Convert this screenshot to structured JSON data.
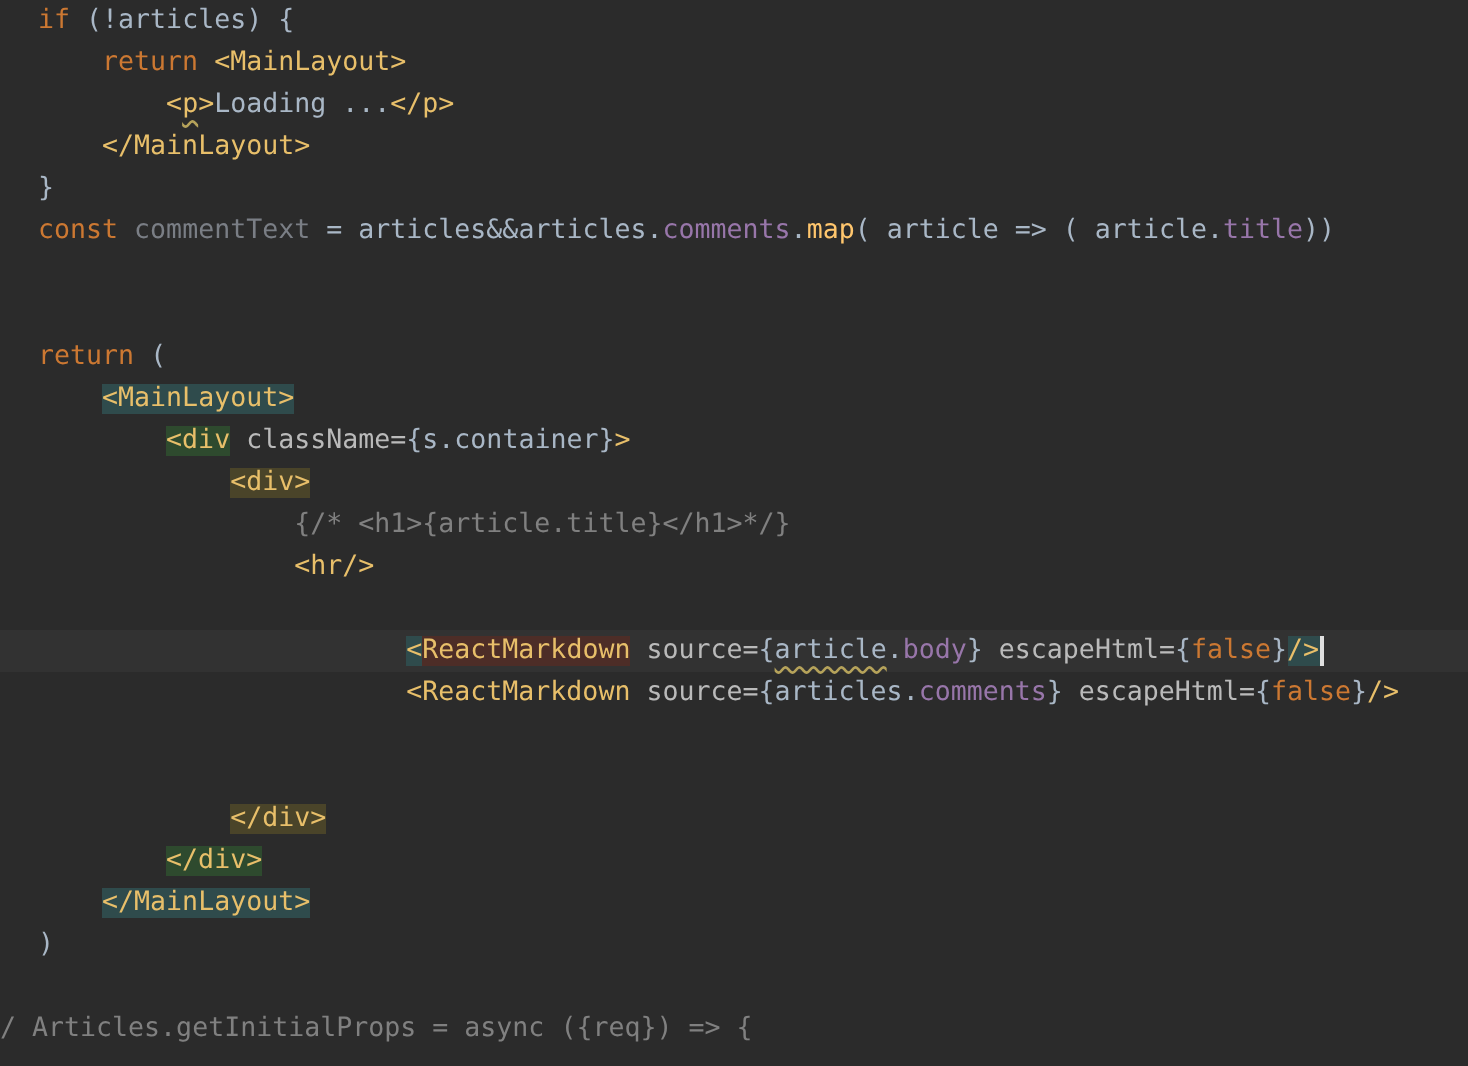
{
  "editor": {
    "lines": [
      {
        "kind": "code",
        "tokens": [
          {
            "t": "if",
            "kind": "kw"
          },
          {
            "t": " (!articles) {",
            "kind": "txt"
          }
        ]
      },
      {
        "kind": "code",
        "tokens": [
          {
            "t": "    return",
            "kind": "kw"
          },
          {
            "t": " <MainLayout>",
            "kind": "tag"
          }
        ]
      },
      {
        "kind": "code",
        "tokens": [
          {
            "t": "        <",
            "kind": "tag"
          },
          {
            "t": "p",
            "kind": "tag",
            "warn": true
          },
          {
            "t": ">",
            "kind": "tag"
          },
          {
            "t": "Loading ...",
            "kind": "txt"
          },
          {
            "t": "</p>",
            "kind": "tag"
          }
        ]
      },
      {
        "kind": "code",
        "tokens": [
          {
            "t": "    </MainLayout>",
            "kind": "tag"
          }
        ]
      },
      {
        "kind": "code",
        "tokens": [
          {
            "t": "}",
            "kind": "txt"
          }
        ]
      },
      {
        "kind": "code",
        "tokens": [
          {
            "t": "const",
            "kind": "kw"
          },
          {
            "t": " commentText",
            "kind": "unused"
          },
          {
            "t": " = articles&&articles.",
            "kind": "txt"
          },
          {
            "t": "comments",
            "kind": "prop"
          },
          {
            "t": ".",
            "kind": "txt"
          },
          {
            "t": "map",
            "kind": "fn"
          },
          {
            "t": "( article => ( article.",
            "kind": "txt"
          },
          {
            "t": "title",
            "kind": "prop"
          },
          {
            "t": "))",
            "kind": "txt"
          }
        ]
      },
      {
        "kind": "blank"
      },
      {
        "kind": "blank"
      },
      {
        "kind": "code",
        "tokens": [
          {
            "t": "return",
            "kind": "kw"
          },
          {
            "t": " (",
            "kind": "txt"
          }
        ]
      },
      {
        "kind": "code",
        "tokens": [
          {
            "t": "    <MainLayout>",
            "kind": "tag",
            "color": "#2f4b4c"
          }
        ]
      },
      {
        "kind": "code",
        "tokens": [
          {
            "t": "        <div",
            "kind": "tag",
            "color": "#2e4a2e"
          },
          {
            "t": " className=",
            "kind": "attr"
          },
          {
            "t": "{s.container}",
            "kind": "txt"
          },
          {
            "t": ">",
            "kind": "tag"
          }
        ]
      },
      {
        "kind": "code",
        "tokens": [
          {
            "t": "            <div>",
            "kind": "tag",
            "color": "#4a4429"
          }
        ]
      },
      {
        "kind": "code",
        "tokens": [
          {
            "t": "                {/* <h1>{article.title}</h1>*/}",
            "kind": "cmt"
          }
        ]
      },
      {
        "kind": "code",
        "tokens": [
          {
            "t": "                <hr/>",
            "kind": "tag"
          }
        ]
      },
      {
        "kind": "blank"
      },
      {
        "kind": "code",
        "current": true,
        "tokens": [
          {
            "t": "                       <",
            "kind": "tag",
            "color": "#2f4b4c"
          },
          {
            "t": "ReactMarkdown",
            "kind": "tag",
            "color": "#4d2d27"
          },
          {
            "t": " source=",
            "kind": "attr"
          },
          {
            "t": "{",
            "kind": "txt"
          },
          {
            "t": "article",
            "kind": "txt",
            "warn": true
          },
          {
            "t": ".",
            "kind": "txt"
          },
          {
            "t": "body",
            "kind": "prop"
          },
          {
            "t": "} ",
            "kind": "txt"
          },
          {
            "t": "escapeHtml=",
            "kind": "attr"
          },
          {
            "t": "{",
            "kind": "txt"
          },
          {
            "t": "false",
            "kind": "kw"
          },
          {
            "t": "}",
            "kind": "txt"
          },
          {
            "t": "/>",
            "kind": "tag",
            "color": "#2f4b4c",
            "cursor": true
          }
        ]
      },
      {
        "kind": "code",
        "tokens": [
          {
            "t": "                       <ReactMarkdown",
            "kind": "tag"
          },
          {
            "t": " source=",
            "kind": "attr"
          },
          {
            "t": "{articles.",
            "kind": "txt"
          },
          {
            "t": "comments",
            "kind": "prop"
          },
          {
            "t": "} ",
            "kind": "txt"
          },
          {
            "t": "escapeHtml=",
            "kind": "attr"
          },
          {
            "t": "{",
            "kind": "txt"
          },
          {
            "t": "false",
            "kind": "kw"
          },
          {
            "t": "}",
            "kind": "txt"
          },
          {
            "t": "/>",
            "kind": "tag"
          }
        ]
      },
      {
        "kind": "blank"
      },
      {
        "kind": "blank"
      },
      {
        "kind": "code",
        "tokens": [
          {
            "t": "            </div>",
            "kind": "tag",
            "color": "#4a4429"
          }
        ]
      },
      {
        "kind": "code",
        "tokens": [
          {
            "t": "        </div>",
            "kind": "tag",
            "color": "#2e4a2e"
          }
        ]
      },
      {
        "kind": "code",
        "tokens": [
          {
            "t": "    </MainLayout>",
            "kind": "tag",
            "color": "#2f4b4c"
          }
        ]
      },
      {
        "kind": "code",
        "tokens": [
          {
            "t": ")",
            "kind": "txt"
          }
        ]
      },
      {
        "kind": "blank"
      },
      {
        "kind": "edge",
        "tokens": [
          {
            "t": "/ Articles.getInitialProps = async ({req}) => {",
            "kind": "cmt"
          }
        ]
      }
    ]
  }
}
